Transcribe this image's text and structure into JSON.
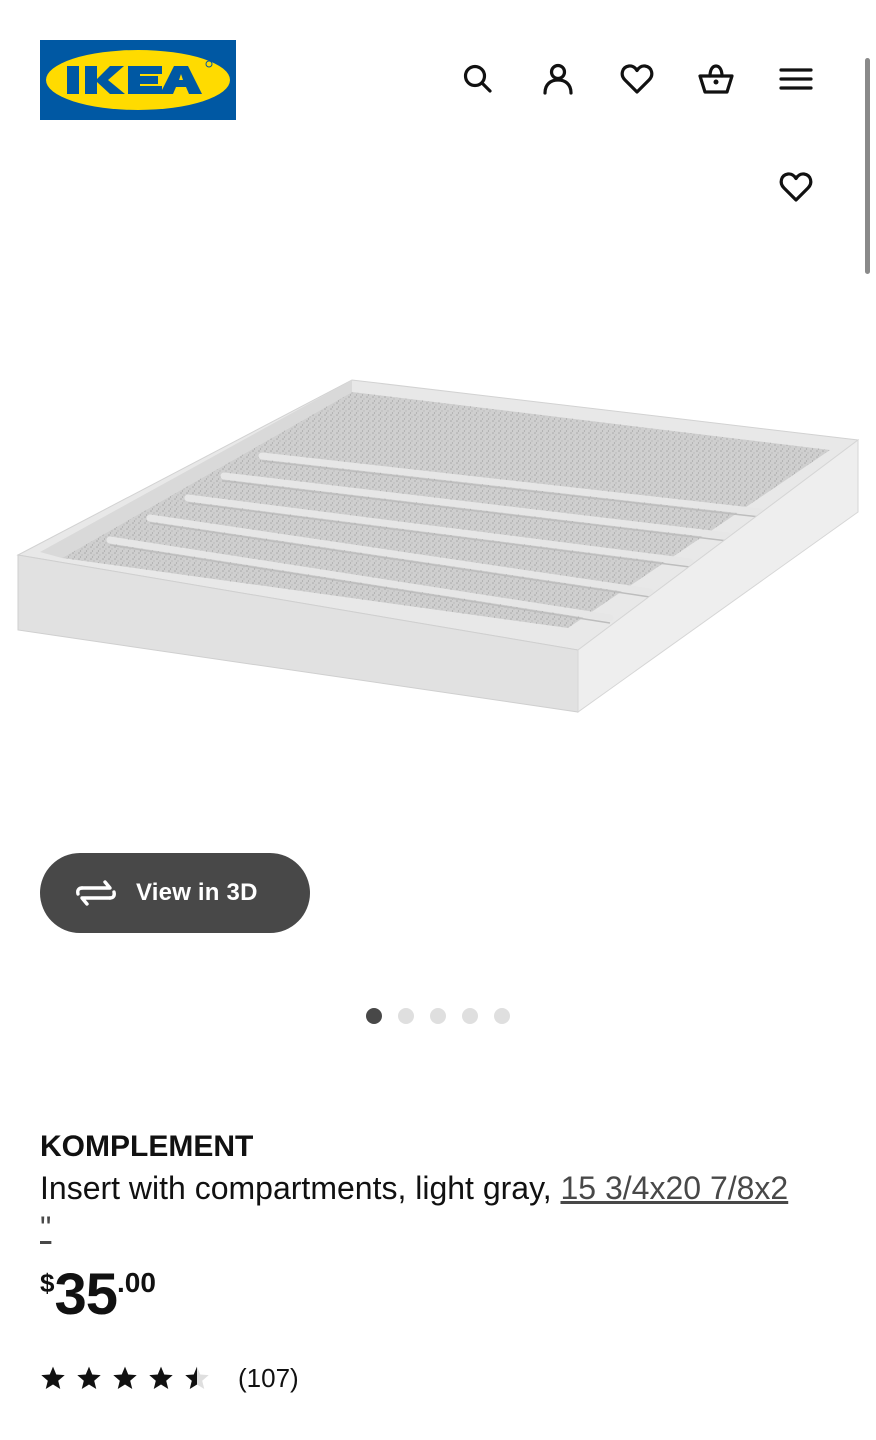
{
  "header": {
    "logo_text": "IKEA",
    "icons": [
      "search-icon",
      "account-icon",
      "favorites-icon",
      "cart-icon",
      "menu-icon"
    ]
  },
  "product_image": {
    "favorite_icon": "heart-icon"
  },
  "view_3d": {
    "label": "View in 3D",
    "icon": "rotate-3d-icon"
  },
  "carousel": {
    "total": 5,
    "active": 1
  },
  "product": {
    "name": "KOMPLEMENT",
    "description": "Insert with compartments, light gray, ",
    "size_link": "15 3/4x20 7/8x2",
    "size_suffix": "\""
  },
  "price": {
    "currency": "$",
    "integer": "35",
    "decimal": ".00"
  },
  "rating": {
    "stars": 4.5,
    "count": "(107)"
  },
  "colors": {
    "ikea_blue": "#0058a3",
    "ikea_yellow": "#ffdb00",
    "button_dark": "#484848",
    "dot_inactive": "#dfdfdf"
  }
}
